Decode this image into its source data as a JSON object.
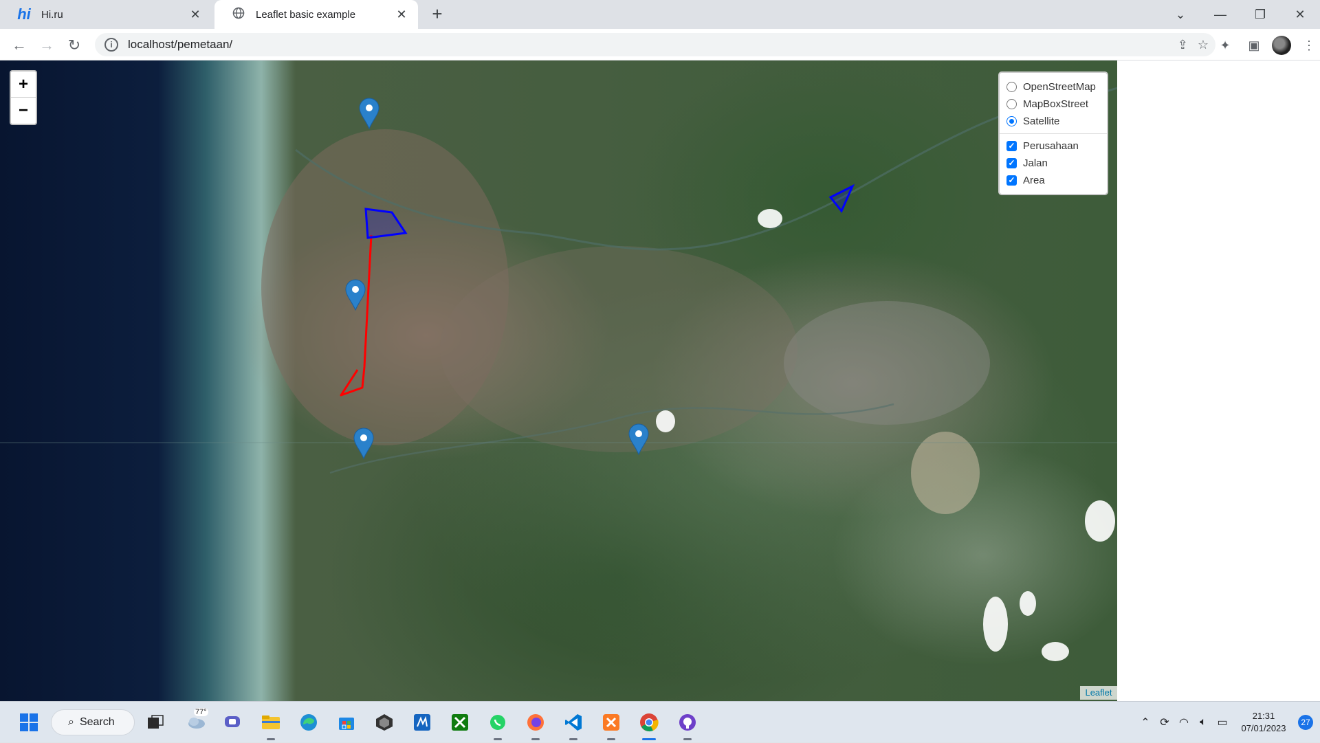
{
  "browser": {
    "tabs": [
      {
        "title": "Hi.ru",
        "favicon": "hi-logo",
        "active": false
      },
      {
        "title": "Leaflet basic example",
        "favicon": "globe-icon",
        "active": true
      }
    ],
    "hi_logo_text": "hi",
    "url": "localhost/pemetaan/"
  },
  "map": {
    "zoom_in": "+",
    "zoom_out": "−",
    "base_layers": [
      {
        "label": "OpenStreetMap",
        "selected": false
      },
      {
        "label": "MapBoxStreet",
        "selected": false
      },
      {
        "label": "Satellite",
        "selected": true
      }
    ],
    "overlays": [
      {
        "label": "Perusahaan",
        "checked": true
      },
      {
        "label": "Jalan",
        "checked": true
      },
      {
        "label": "Area",
        "checked": true
      }
    ],
    "attribution": "Leaflet",
    "colors": {
      "marker": "#2a81cb",
      "polyline": "#ff0000",
      "polygon": "#0000ff"
    }
  },
  "taskbar": {
    "search_label": "Search",
    "weather_temp": "77°",
    "apps": [
      "task-view-icon",
      "weather-icon",
      "teams-chat-icon",
      "file-explorer-icon",
      "edge-icon",
      "store-icon",
      "unity-icon",
      "vscode-insiders-icon",
      "xbox-icon",
      "whatsapp-icon",
      "firefox-icon",
      "vscode-icon",
      "xampp-icon",
      "chrome-icon",
      "github-desktop-icon"
    ],
    "clock_time": "21:31",
    "clock_date": "07/01/2023",
    "notification_count": "27"
  }
}
